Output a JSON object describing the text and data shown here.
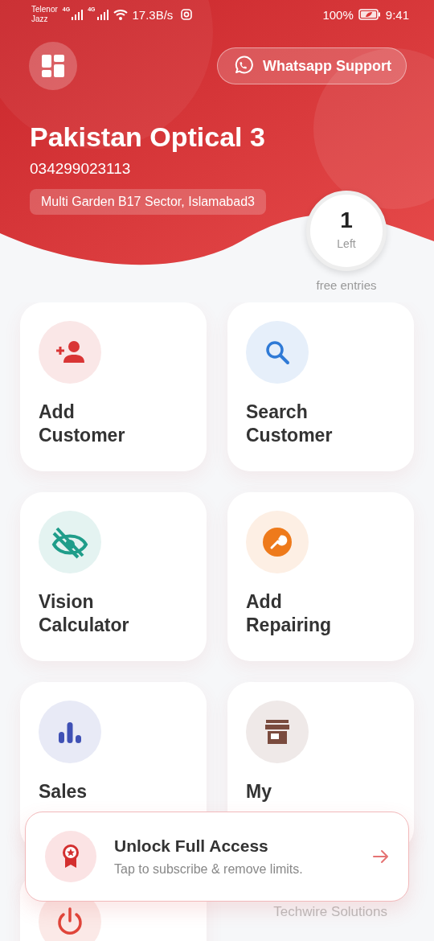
{
  "status_bar": {
    "carrier_1": "Telenor",
    "carrier_2": "Jazz",
    "network_1": "4G",
    "network_2": "4G",
    "speed": "17.3B/s",
    "battery": "100%",
    "time": "9:41"
  },
  "header": {
    "support_button": "Whatsapp Support",
    "shop_name": "Pakistan Optical 3",
    "phone": "034299023113",
    "address": "Multi Garden B17 Sector, Islamabad3"
  },
  "entries": {
    "count": "1",
    "unit": "Left",
    "caption": "free entries"
  },
  "features": [
    {
      "kind": "add-customer",
      "title_lines": [
        "Add",
        "Customer"
      ],
      "color": "#d93535"
    },
    {
      "kind": "search",
      "title_lines": [
        "Search",
        "Customer"
      ],
      "color": "#2f7ad6"
    },
    {
      "kind": "vision",
      "title_lines": [
        "Vision",
        "Calculator"
      ],
      "color": "#1f9d8a"
    },
    {
      "kind": "repair",
      "title_lines": [
        "Add",
        "Repairing"
      ],
      "color": "#ee7a1b"
    },
    {
      "kind": "sales",
      "title_lines": [
        "Sales"
      ],
      "color": "#3f51b5"
    },
    {
      "kind": "shop",
      "title_lines": [
        "My"
      ],
      "color": "#7a4b3e"
    },
    {
      "kind": "logout",
      "color": "#e0453a"
    }
  ],
  "footer": "Techwire Solutions",
  "promo": {
    "title": "Unlock Full Access",
    "subtitle": "Tap to subscribe & remove limits."
  }
}
